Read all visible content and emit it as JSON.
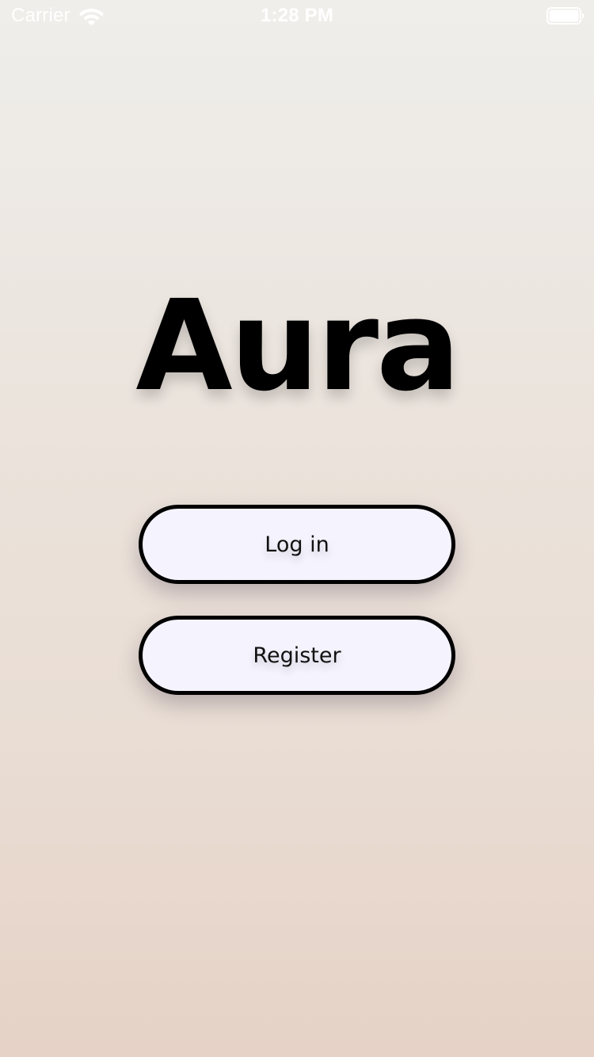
{
  "status_bar": {
    "carrier": "Carrier",
    "time": "1:28 PM",
    "wifi_icon": "wifi-icon",
    "battery_icon": "battery-icon"
  },
  "app": {
    "title": "Aura"
  },
  "buttons": {
    "login_label": "Log in",
    "register_label": "Register"
  },
  "colors": {
    "background_top": "#efeeeb",
    "background_bottom": "#e6d2c6",
    "button_fill": "#f5f3fd",
    "button_border": "#000000",
    "text": "#000000",
    "status_text": "#ffffff"
  }
}
